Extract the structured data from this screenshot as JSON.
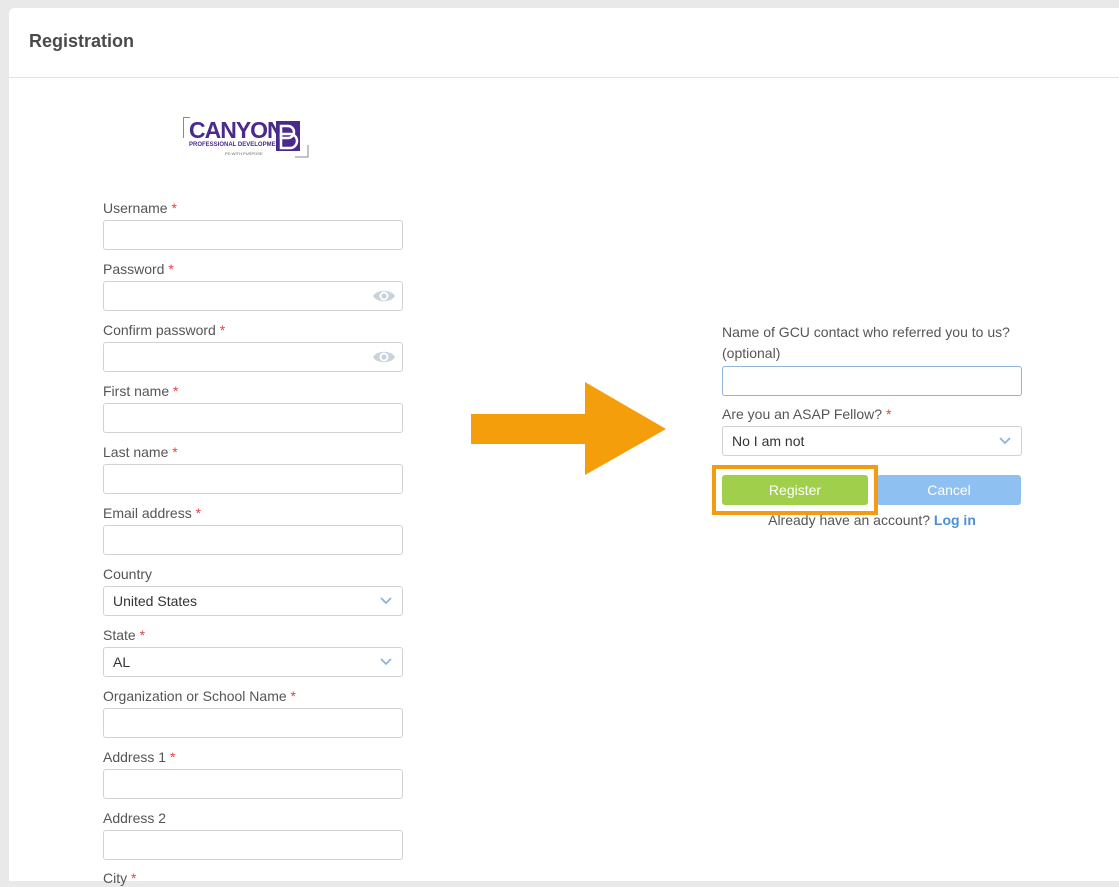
{
  "page": {
    "title": "Registration"
  },
  "logo": {
    "word": "CANYON",
    "sub": "PROFESSIONAL DEVELOPMENT",
    "tagline": "PD WITH PURPOSE",
    "mark_letter": "PD"
  },
  "required_marker": "*",
  "form": {
    "username": {
      "label": "Username",
      "value": ""
    },
    "password": {
      "label": "Password",
      "value": ""
    },
    "confirm_password": {
      "label": "Confirm password",
      "value": ""
    },
    "first_name": {
      "label": "First name",
      "value": ""
    },
    "last_name": {
      "label": "Last name",
      "value": ""
    },
    "email": {
      "label": "Email address",
      "value": ""
    },
    "country": {
      "label": "Country",
      "value": "United States"
    },
    "state": {
      "label": "State",
      "value": "AL"
    },
    "organization": {
      "label": "Organization or School Name",
      "value": ""
    },
    "address1": {
      "label": "Address 1",
      "value": ""
    },
    "address2": {
      "label": "Address 2",
      "value": ""
    },
    "city": {
      "label": "City"
    }
  },
  "right": {
    "referral": {
      "label": "Name of GCU contact who referred you to us? (optional)",
      "value": ""
    },
    "asap": {
      "label": "Are you an ASAP Fellow?",
      "value": "No I am not"
    },
    "register_label": "Register",
    "cancel_label": "Cancel",
    "already_text": "Already have an account?",
    "login_label": "Log in"
  },
  "colors": {
    "highlight": "#f39c12",
    "arrow": "#f59e0b",
    "register": "#9fcf4b",
    "cancel": "#8ec0f2",
    "link": "#4a90d9",
    "brand": "#4b2a8e"
  }
}
